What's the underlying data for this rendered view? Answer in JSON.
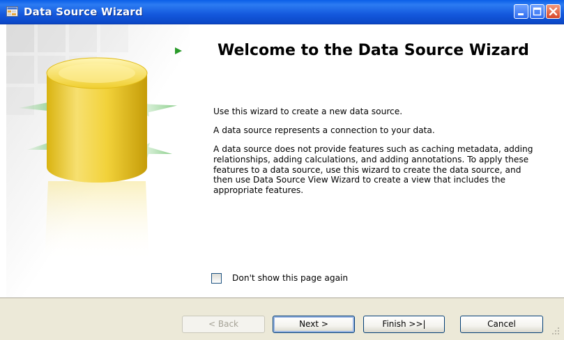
{
  "window": {
    "title": "Data Source Wizard",
    "icons": {
      "app": "data-source-app-icon",
      "minimize": "minimize-icon",
      "maximize": "maximize-icon",
      "close": "close-icon"
    }
  },
  "page": {
    "title": "Welcome to the Data Source Wizard",
    "paragraphs": [
      "Use this wizard to create a new data source.",
      "A data source represents a connection to your data.",
      "A data source does not provide features such as caching metadata, adding relationships, adding calculations, and adding annotations. To apply these features to a data source, use this wizard to create the data source, and then use Data Source View Wizard to create a view that includes the appropriate features."
    ],
    "checkbox": {
      "label": "Don't show this page again",
      "checked": false
    }
  },
  "buttons": {
    "back": "< Back",
    "next": "Next >",
    "finish": "Finish >>|",
    "cancel": "Cancel"
  },
  "colors": {
    "titlebar": "#0a5fe8",
    "accent_arrow": "#2a9a2a",
    "cylinder": "#f2d23a",
    "dialog_face": "#ece9d8"
  }
}
